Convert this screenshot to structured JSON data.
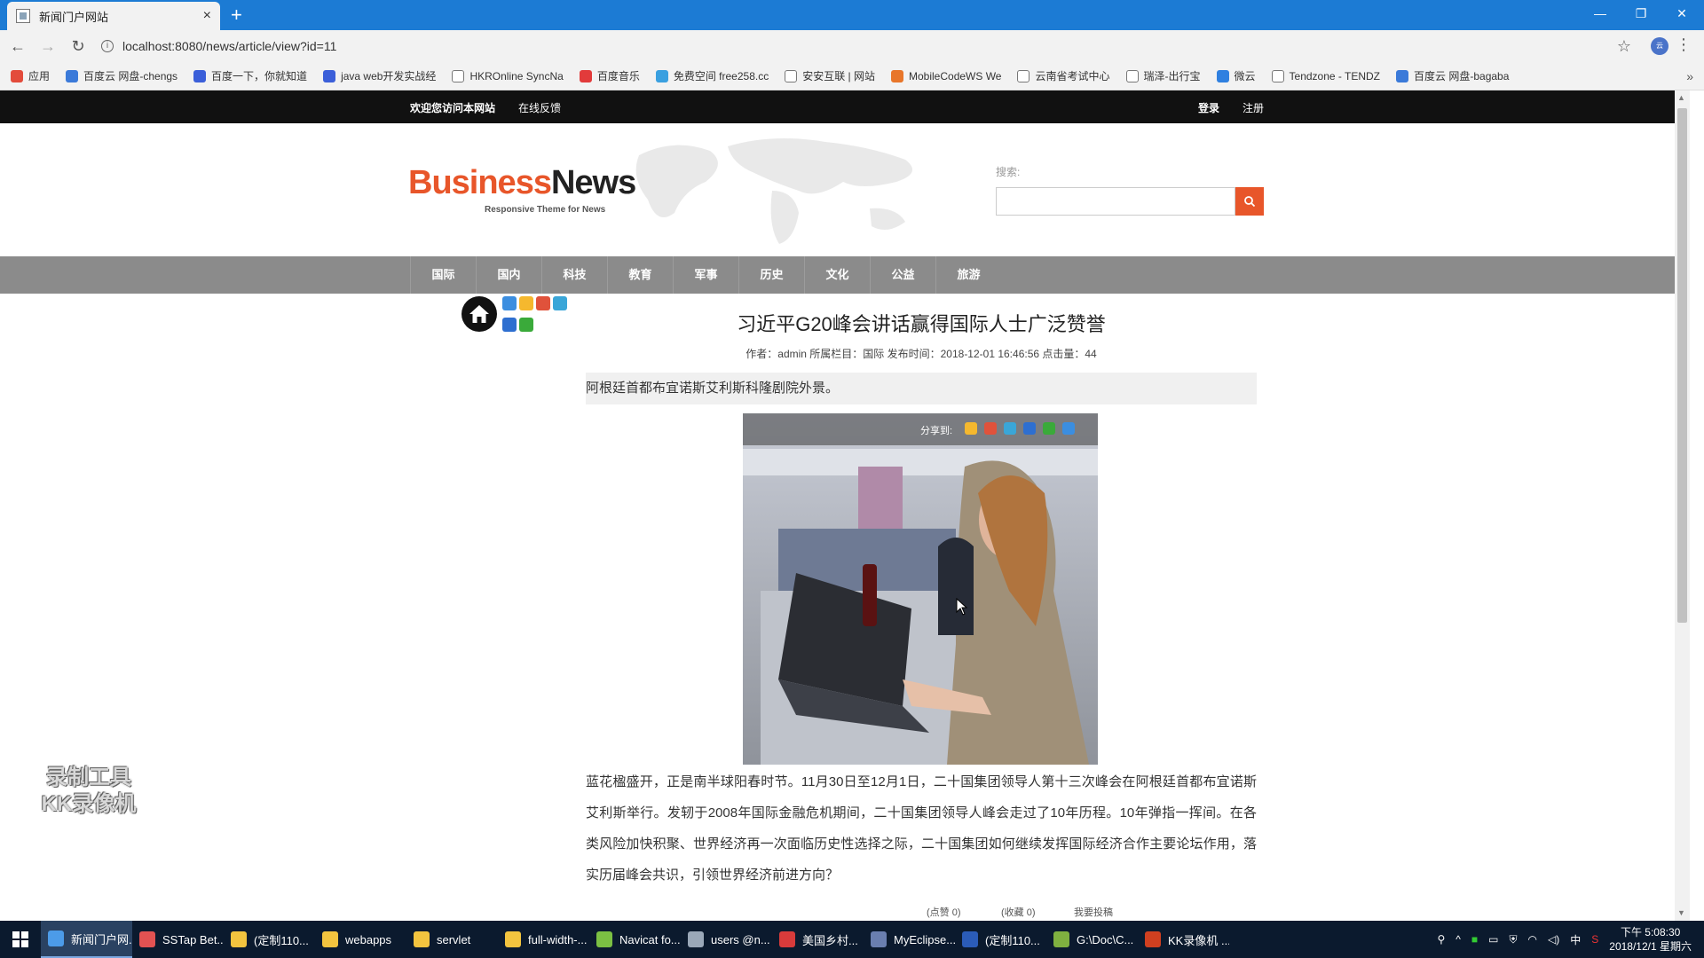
{
  "browser": {
    "tab_title": "新闻门户网站",
    "url": "localhost:8080/news/article/view?id=11",
    "bookmarks": [
      {
        "label": "应用",
        "icon": "apps-grid-icon",
        "color": "#e34b3b"
      },
      {
        "label": "百度云 网盘-chengs",
        "icon": "baidu-cloud-icon",
        "color": "#3b7ad9"
      },
      {
        "label": "百度一下，你就知道",
        "icon": "baidu-paw-icon",
        "color": "#3b5fd9"
      },
      {
        "label": "java web开发实战经",
        "icon": "baidu-paw-icon",
        "color": "#3b5fd9"
      },
      {
        "label": "HKROnline SyncNa",
        "icon": "page-icon",
        "color": "#ffffff"
      },
      {
        "label": "百度音乐",
        "icon": "music-icon",
        "color": "#e23b3b"
      },
      {
        "label": "免费空间 free258.cc",
        "icon": "globe-icon",
        "color": "#3aa0e0"
      },
      {
        "label": "安安互联 | 网站",
        "icon": "page-icon",
        "color": "#ffffff"
      },
      {
        "label": "MobileCodeWS We",
        "icon": "codeicon",
        "color": "#e8762a"
      },
      {
        "label": "云南省考试中心",
        "icon": "page-icon",
        "color": "#ffffff"
      },
      {
        "label": "瑞泽-出行宝",
        "icon": "page-icon",
        "color": "#ffffff"
      },
      {
        "label": "微云",
        "icon": "weiyun-icon",
        "color": "#2f80e0"
      },
      {
        "label": "Tendzone - TENDZ",
        "icon": "page-icon",
        "color": "#ffffff"
      },
      {
        "label": "百度云 网盘-bagaba",
        "icon": "baidu-cloud-icon",
        "color": "#3b7ad9"
      }
    ]
  },
  "site": {
    "topbar": {
      "welcome": "欢迎您访问本网站",
      "feedback": "在线反馈",
      "login": "登录",
      "register": "注册"
    },
    "logo": {
      "business": "Business",
      "news": "News",
      "tagline": "Responsive Theme for News"
    },
    "search": {
      "label": "搜索:",
      "value": "",
      "placeholder": ""
    },
    "nav": [
      "国际",
      "国内",
      "科技",
      "教育",
      "军事",
      "历史",
      "文化",
      "公益",
      "旅游"
    ]
  },
  "article": {
    "title": "习近平G20峰会讲话赢得国际人士广泛赞誉",
    "meta": "作者：admin  所属栏目：国际  发布时间：2018-12-01 16:46:56  点击量：44",
    "summary": "阿根廷首都布宜诺斯艾利斯科隆剧院外景。",
    "share_label": "分享到:",
    "body": "蓝花楹盛开，正是南半球阳春时节。11月30日至12月1日，二十国集团领导人第十三次峰会在阿根廷首都布宜诺斯艾利斯举行。发轫于2008年国际金融危机期间，二十国集团领导人峰会走过了10年历程。10年弹指一挥间。在各类风险加快积聚、世界经济再一次面临历史性选择之际，二十国集团如何继续发挥国际经济合作主要论坛作用，落实历届峰会共识，引领世界经济前进方向？",
    "actions": {
      "like": "(点赞 0)",
      "collect": "(收藏 0)",
      "submit": "我要投稿"
    }
  },
  "watermark": {
    "line1": "录制工具",
    "line2": "KK录像机"
  },
  "taskbar": {
    "items": [
      {
        "label": "新闻门户网...",
        "icon": "chrome-icon",
        "color": "#4c9be8",
        "active": true
      },
      {
        "label": "SSTap Bet...",
        "icon": "shield-icon",
        "color": "#e25252"
      },
      {
        "label": "(定制110...",
        "icon": "folder-icon",
        "color": "#f3c43f"
      },
      {
        "label": "webapps",
        "icon": "folder-icon",
        "color": "#f3c43f"
      },
      {
        "label": "servlet",
        "icon": "folder-icon",
        "color": "#f3c43f"
      },
      {
        "label": "full-width-...",
        "icon": "folder-icon",
        "color": "#f3c43f"
      },
      {
        "label": "Navicat fo...",
        "icon": "navicat-icon",
        "color": "#7bc043"
      },
      {
        "label": "users @n...",
        "icon": "db-table-icon",
        "color": "#9aa8b8"
      },
      {
        "label": "美国乡村...",
        "icon": "netease-music-icon",
        "color": "#d83b3b"
      },
      {
        "label": "MyEclipse...",
        "icon": "eclipse-icon",
        "color": "#6a7fb0"
      },
      {
        "label": "(定制110...",
        "icon": "word-icon",
        "color": "#2b5cb8"
      },
      {
        "label": "G:\\Doc\\C...",
        "icon": "notepad-icon",
        "color": "#7fb040"
      },
      {
        "label": "KK录像机 ...",
        "icon": "kk-recorder-icon",
        "color": "#d04020"
      }
    ],
    "clock_time": "下午 5:08:30",
    "clock_date": "2018/12/1 星期六",
    "ime": "中"
  }
}
